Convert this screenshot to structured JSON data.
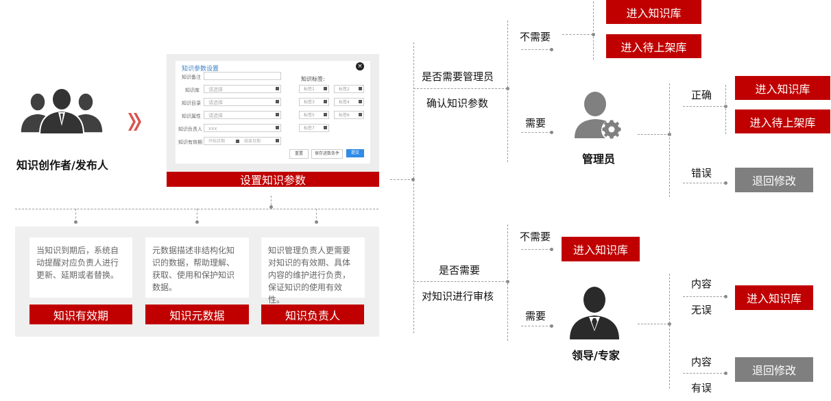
{
  "creator": {
    "label": "知识创作者/发布人"
  },
  "form": {
    "title": "知识参数设置",
    "fields": [
      {
        "label": "知识备注",
        "placeholder": ""
      },
      {
        "label": "知识库",
        "placeholder": "请选择"
      },
      {
        "label": "知识目录",
        "placeholder": "请选择"
      },
      {
        "label": "知识属性",
        "placeholder": "请选择"
      },
      {
        "label": "知识负责人",
        "placeholder": "xxx"
      },
      {
        "label": "知识有效期",
        "start": "开始日期",
        "end": "结束日期"
      }
    ],
    "tags_label": "知识标签:",
    "tags": [
      "标签1",
      "标签2",
      "标签3",
      "标签4",
      "标签5",
      "标签6",
      "标签7"
    ],
    "buttons": {
      "reset": "重置",
      "save_cond": "保存进数条件",
      "submit": "提交"
    },
    "caption": "设置知识参数"
  },
  "cards": [
    {
      "text": "当知识到期后，系统自动提醒对应负责人进行更新、延期或者替换。",
      "title": "知识有效期"
    },
    {
      "text": "元数据描述非结构化知识的数据，帮助理解、获取、使用和保护知识数据。",
      "title": "知识元数据"
    },
    {
      "text": "知识管理负责人更需要对知识的有效期、具体内容的维护进行负责，保证知识的使用有效性。",
      "title": "知识负责人"
    }
  ],
  "top_branch": {
    "question1": "是否需要管理员",
    "question2": "确认知识参数",
    "no": "不需要",
    "yes": "需要",
    "to_kb": "进入知识库",
    "to_pending": "进入待上架库",
    "admin": "管理员",
    "correct": "正确",
    "error": "错误",
    "correct_kb": "进入知识库",
    "correct_pending": "进入待上架库",
    "back": "退回修改"
  },
  "bottom_branch": {
    "question1": "是否需要",
    "question2": "对知识进行审核",
    "no": "不需要",
    "yes": "需要",
    "to_kb": "进入知识库",
    "leader": "领导/专家",
    "ok1": "内容",
    "ok2": "无误",
    "err1": "内容",
    "err2": "有误",
    "ok_kb": "进入知识库",
    "back": "退回修改"
  }
}
